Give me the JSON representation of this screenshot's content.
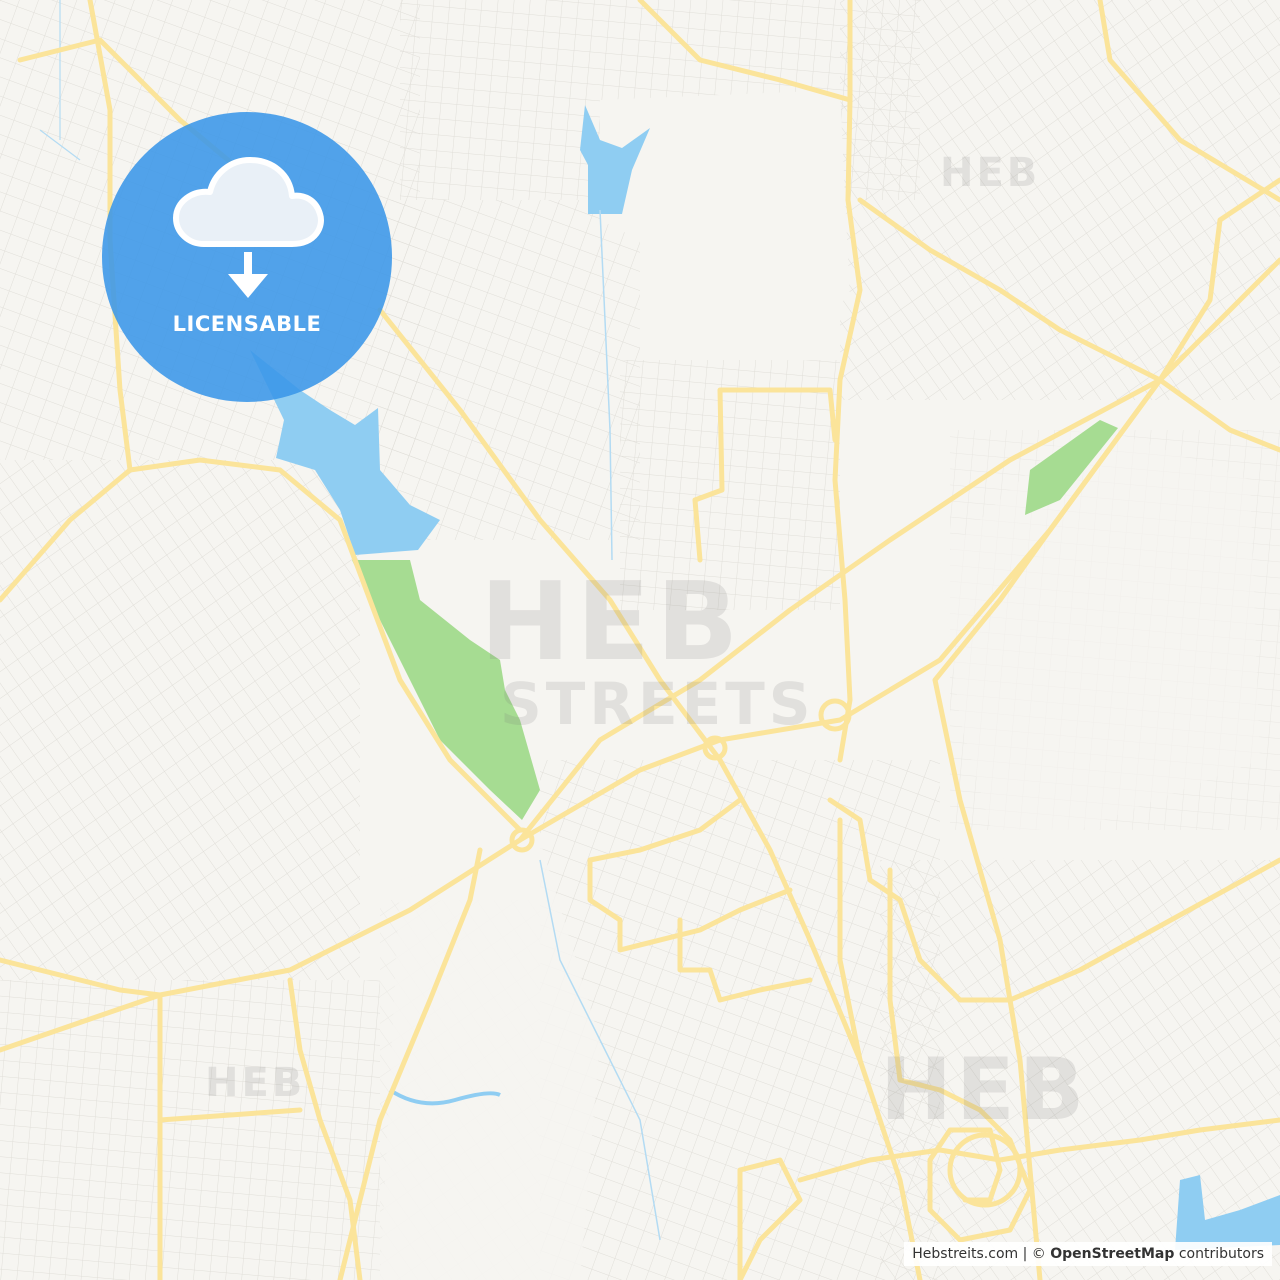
{
  "badge": {
    "label": "LICENSABLE",
    "icon": "cloud-download-icon",
    "color": "#3a96e8"
  },
  "watermark": {
    "brand": "HEB",
    "streets": "STREETS"
  },
  "attribution": {
    "site": "Hebstreits.com",
    "separator": " | © ",
    "osm": "OpenStreetMap",
    "suffix": " contributors"
  },
  "colors": {
    "land": "#f6f5f1",
    "road_major": "#fbe49a",
    "road_minor": "#dddcd7",
    "water": "#8fcdf2",
    "park": "#a6dc92"
  }
}
